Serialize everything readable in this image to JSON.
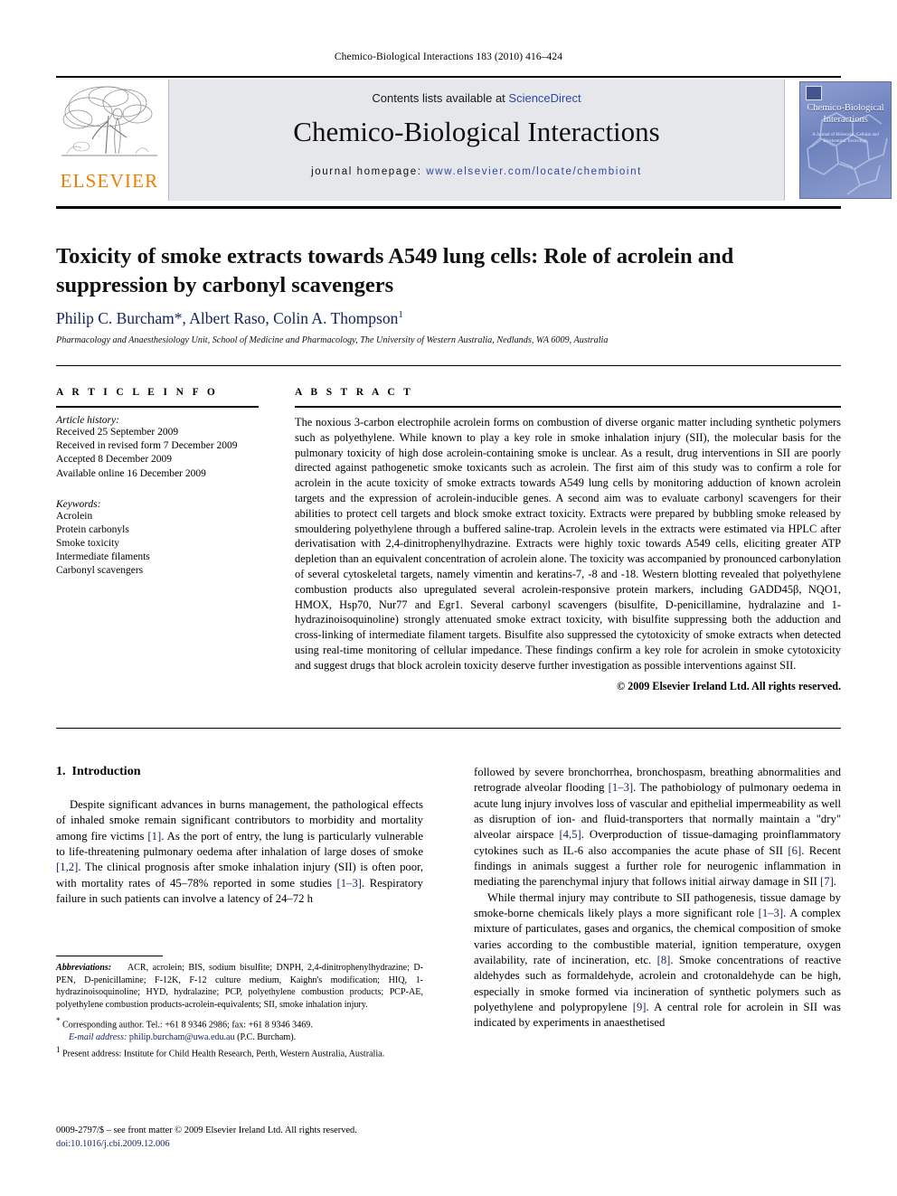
{
  "running_head": "Chemico-Biological Interactions 183 (2010) 416–424",
  "masthead": {
    "publisher_logo_text": "ELSEVIER",
    "contents_prefix": "Contents lists available at ",
    "contents_link": "ScienceDirect",
    "journal_title": "Chemico-Biological Interactions",
    "homepage_prefix": "journal homepage: ",
    "homepage_url": "www.elsevier.com/locate/chembioint",
    "cover": {
      "title": "Chemico-Biological Interactions",
      "subtitle": "A Journal of Molecular, Cellular and Biochemical Toxicology",
      "accent_color": "#7f92c8"
    },
    "band_color": "#e6e7eb",
    "elsevier_orange": "#f07d00",
    "link_color": "#2b49a8"
  },
  "article": {
    "title": "Toxicity of smoke extracts towards A549 lung cells: Role of acrolein and suppression by carbonyl scavengers",
    "authors_html": "Philip C. Burcham*, Albert Raso, Colin A. Thompson",
    "author_marker_1": "1",
    "affiliation": "Pharmacology and Anaesthesiology Unit, School of Medicine and Pharmacology, The University of Western Australia, Nedlands, WA 6009, Australia",
    "author_color": "#13225c"
  },
  "info": {
    "heading": "A R T I C L E    I N F O",
    "history_label": "Article history:",
    "history": [
      "Received 25 September 2009",
      "Received in revised form 7 December 2009",
      "Accepted 8 December 2009",
      "Available online 16 December 2009"
    ],
    "keywords_label": "Keywords:",
    "keywords": [
      "Acrolein",
      "Protein carbonyls",
      "Smoke toxicity",
      "Intermediate filaments",
      "Carbonyl scavengers"
    ]
  },
  "abstract": {
    "heading": "A B S T R A C T",
    "body": "The noxious 3-carbon electrophile acrolein forms on combustion of diverse organic matter including synthetic polymers such as polyethylene. While known to play a key role in smoke inhalation injury (SII), the molecular basis for the pulmonary toxicity of high dose acrolein-containing smoke is unclear. As a result, drug interventions in SII are poorly directed against pathogenetic smoke toxicants such as acrolein. The first aim of this study was to confirm a role for acrolein in the acute toxicity of smoke extracts towards A549 lung cells by monitoring adduction of known acrolein targets and the expression of acrolein-inducible genes. A second aim was to evaluate carbonyl scavengers for their abilities to protect cell targets and block smoke extract toxicity. Extracts were prepared by bubbling smoke released by smouldering polyethylene through a buffered saline-trap. Acrolein levels in the extracts were estimated via HPLC after derivatisation with 2,4-dinitrophenylhydrazine. Extracts were highly toxic towards A549 cells, eliciting greater ATP depletion than an equivalent concentration of acrolein alone. The toxicity was accompanied by pronounced carbonylation of several cytoskeletal targets, namely vimentin and keratins-7, -8 and -18. Western blotting revealed that polyethylene combustion products also upregulated several acrolein-responsive protein markers, including GADD45β, NQO1, HMOX, Hsp70, Nur77 and Egr1. Several carbonyl scavengers (bisulfite, D-penicillamine, hydralazine and 1-hydrazinoisoquinoline) strongly attenuated smoke extract toxicity, with bisulfite suppressing both the adduction and cross-linking of intermediate filament targets. Bisulfite also suppressed the cytotoxicity of smoke extracts when detected using real-time monitoring of cellular impedance. These findings confirm a key role for acrolein in smoke cytotoxicity and suggest drugs that block acrolein toxicity deserve further investigation as possible interventions against SII.",
    "copyright": "© 2009 Elsevier Ireland Ltd. All rights reserved."
  },
  "body": {
    "section_number": "1.",
    "section_title": "Introduction",
    "left_paragraph_1": "Despite significant advances in burns management, the pathological effects of inhaled smoke remain significant contributors to morbidity and mortality among fire victims [1]. As the port of entry, the lung is particularly vulnerable to life-threatening pulmonary oedema after inhalation of large doses of smoke [1,2]. The clinical prognosis after smoke inhalation injury (SII) is often poor, with mortality rates of 45–78% reported in some studies [1–3]. Respiratory failure in such patients can involve a latency of 24–72 h",
    "right_paragraph_1": "followed by severe bronchorrhea, bronchospasm, breathing abnormalities and retrograde alveolar flooding [1–3]. The pathobiology of pulmonary oedema in acute lung injury involves loss of vascular and epithelial impermeability as well as disruption of ion- and fluid-transporters that normally maintain a \"dry\" alveolar airspace [4,5]. Overproduction of tissue-damaging proinflammatory cytokines such as IL-6 also accompanies the acute phase of SII [6]. Recent findings in animals suggest a further role for neurogenic inflammation in mediating the parenchymal injury that follows initial airway damage in SII [7].",
    "right_paragraph_2": "While thermal injury may contribute to SII pathogenesis, tissue damage by smoke-borne chemicals likely plays a more significant role [1–3]. A complex mixture of particulates, gases and organics, the chemical composition of smoke varies according to the combustible material, ignition temperature, oxygen availability, rate of incineration, etc. [8]. Smoke concentrations of reactive aldehydes such as formaldehyde, acrolein and crotonaldehyde can be high, especially in smoke formed via incineration of synthetic polymers such as polyethylene and polypropylene [9]. A central role for acrolein in SII was indicated by experiments in anaesthetised"
  },
  "footnotes": {
    "abbrev_label": "Abbreviations:",
    "abbrev_text": "ACR, acrolein; BIS, sodium bisulfite; DNPH, 2,4-dinitrophenylhydrazine; D-PEN, D-penicillamine; F-12K, F-12 culture medium, Kaighn's modification; HIQ, 1-hydrazinoisoquinoline; HYD, hydralazine; PCP, polyethylene combustion products; PCP-AE, polyethylene combustion products-acrolein-equivalents; SII, smoke inhalation injury.",
    "corresponding_marker": "*",
    "corresponding_text": "Corresponding author. Tel.: +61 8 9346 2986; fax: +61 8 9346 3469.",
    "email_label": "E-mail address:",
    "email_value": "philip.burcham@uwa.edu.au",
    "email_owner": "(P.C. Burcham).",
    "present_marker": "1",
    "present_text": "Present address: Institute for Child Health Research, Perth, Western Australia, Australia."
  },
  "imprint": {
    "line1": "0009-2797/$ – see front matter © 2009 Elsevier Ireland Ltd. All rights reserved.",
    "doi_label": "doi:",
    "doi_value": "10.1016/j.cbi.2009.12.006"
  }
}
